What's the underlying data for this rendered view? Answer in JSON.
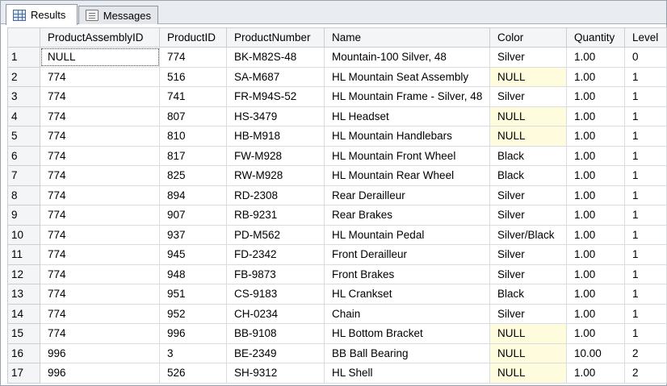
{
  "tabs": [
    {
      "label": "Results",
      "icon": "grid-icon",
      "active": true
    },
    {
      "label": "Messages",
      "icon": "messages-icon",
      "active": false
    }
  ],
  "columns": [
    "ProductAssemblyID",
    "ProductID",
    "ProductNumber",
    "Name",
    "Color",
    "Quantity",
    "Level"
  ],
  "rows": [
    {
      "n": "1",
      "cells": [
        "NULL",
        "774",
        "BK-M82S-48",
        "Mountain-100 Silver, 48",
        "Silver",
        "1.00",
        "0"
      ]
    },
    {
      "n": "2",
      "cells": [
        "774",
        "516",
        "SA-M687",
        "HL Mountain Seat Assembly",
        "NULL",
        "1.00",
        "1"
      ]
    },
    {
      "n": "3",
      "cells": [
        "774",
        "741",
        "FR-M94S-52",
        "HL Mountain Frame - Silver, 48",
        "Silver",
        "1.00",
        "1"
      ]
    },
    {
      "n": "4",
      "cells": [
        "774",
        "807",
        "HS-3479",
        "HL Headset",
        "NULL",
        "1.00",
        "1"
      ]
    },
    {
      "n": "5",
      "cells": [
        "774",
        "810",
        "HB-M918",
        "HL Mountain Handlebars",
        "NULL",
        "1.00",
        "1"
      ]
    },
    {
      "n": "6",
      "cells": [
        "774",
        "817",
        "FW-M928",
        "HL Mountain Front Wheel",
        "Black",
        "1.00",
        "1"
      ]
    },
    {
      "n": "7",
      "cells": [
        "774",
        "825",
        "RW-M928",
        "HL Mountain Rear Wheel",
        "Black",
        "1.00",
        "1"
      ]
    },
    {
      "n": "8",
      "cells": [
        "774",
        "894",
        "RD-2308",
        "Rear Derailleur",
        "Silver",
        "1.00",
        "1"
      ]
    },
    {
      "n": "9",
      "cells": [
        "774",
        "907",
        "RB-9231",
        "Rear Brakes",
        "Silver",
        "1.00",
        "1"
      ]
    },
    {
      "n": "10",
      "cells": [
        "774",
        "937",
        "PD-M562",
        "HL Mountain Pedal",
        "Silver/Black",
        "1.00",
        "1"
      ]
    },
    {
      "n": "11",
      "cells": [
        "774",
        "945",
        "FD-2342",
        "Front Derailleur",
        "Silver",
        "1.00",
        "1"
      ]
    },
    {
      "n": "12",
      "cells": [
        "774",
        "948",
        "FB-9873",
        "Front Brakes",
        "Silver",
        "1.00",
        "1"
      ]
    },
    {
      "n": "13",
      "cells": [
        "774",
        "951",
        "CS-9183",
        "HL Crankset",
        "Black",
        "1.00",
        "1"
      ]
    },
    {
      "n": "14",
      "cells": [
        "774",
        "952",
        "CH-0234",
        "Chain",
        "Silver",
        "1.00",
        "1"
      ]
    },
    {
      "n": "15",
      "cells": [
        "774",
        "996",
        "BB-9108",
        "HL Bottom Bracket",
        "NULL",
        "1.00",
        "1"
      ]
    },
    {
      "n": "16",
      "cells": [
        "996",
        "3",
        "BE-2349",
        "BB Ball Bearing",
        "NULL",
        "10.00",
        "2"
      ]
    },
    {
      "n": "17",
      "cells": [
        "996",
        "526",
        "SH-9312",
        "HL Shell",
        "NULL",
        "1.00",
        "2"
      ]
    }
  ],
  "colors": {
    "null_highlight": "#fffbdd",
    "header_bg": "#f3f5f7",
    "grid_line": "#d9dde2"
  }
}
